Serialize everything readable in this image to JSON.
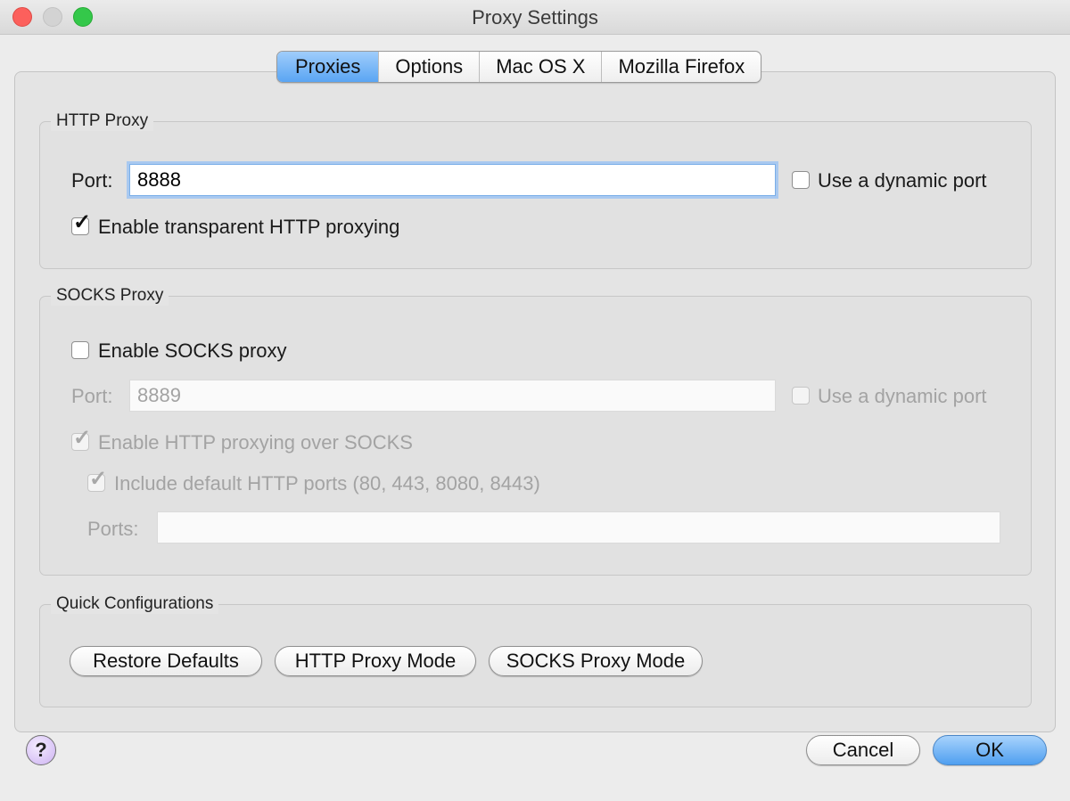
{
  "window": {
    "title": "Proxy Settings"
  },
  "tabs": [
    {
      "label": "Proxies",
      "active": true
    },
    {
      "label": "Options",
      "active": false
    },
    {
      "label": "Mac OS X",
      "active": false
    },
    {
      "label": "Mozilla Firefox",
      "active": false
    }
  ],
  "http_proxy": {
    "title": "HTTP Proxy",
    "port_label": "Port:",
    "port_value": "8888",
    "dynamic_port_label": "Use a dynamic port",
    "dynamic_port_checked": false,
    "transparent_label": "Enable transparent HTTP proxying",
    "transparent_checked": true
  },
  "socks_proxy": {
    "title": "SOCKS Proxy",
    "enable_label": "Enable SOCKS proxy",
    "enable_checked": false,
    "port_label": "Port:",
    "port_value": "8889",
    "dynamic_port_label": "Use a dynamic port",
    "http_over_socks_label": "Enable HTTP proxying over SOCKS",
    "http_over_socks_checked": true,
    "include_ports_label": "Include default HTTP ports (80, 443, 8080, 8443)",
    "include_ports_checked": true,
    "ports_label": "Ports:",
    "ports_value": ""
  },
  "quick": {
    "title": "Quick Configurations",
    "restore_label": "Restore Defaults",
    "http_mode_label": "HTTP Proxy Mode",
    "socks_mode_label": "SOCKS Proxy Mode"
  },
  "footer": {
    "help_label": "?",
    "cancel_label": "Cancel",
    "ok_label": "OK"
  },
  "colors": {
    "accent": "#5aa5f3",
    "close": "#fc605c",
    "maximize": "#34c84a"
  }
}
